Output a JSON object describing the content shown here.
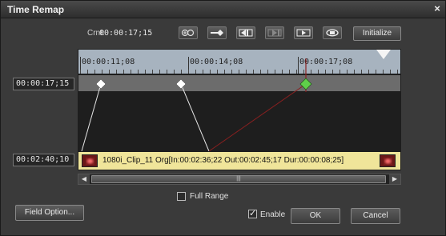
{
  "window": {
    "title": "Time Remap",
    "close_glyph": "×"
  },
  "toolbar": {
    "current_label": "Crnt:",
    "current_timecode": "00:00:17;15",
    "icons": [
      "add-key-icon",
      "prev-key-icon",
      "step-back-icon",
      "step-forward-icon",
      "play-icon",
      "loop-icon"
    ],
    "initialize_label": "Initialize"
  },
  "ruler": {
    "ticks": [
      "00:00:11;08",
      "00:00:14;08",
      "00:00:17;08"
    ]
  },
  "timecodes": {
    "playhead": "00:00:17;15",
    "source": "00:02:40;10"
  },
  "clip": {
    "label": "1080i_Clip_11  Org[In:00:02:36;22 Out:00:02:45;17 Dur:00:00:08;25]"
  },
  "options": {
    "full_range_label": "Full Range",
    "full_range_checked": false,
    "enable_label": "Enable",
    "enable_checked": true
  },
  "buttons": {
    "field_option": "Field Option...",
    "ok": "OK",
    "cancel": "Cancel"
  },
  "colors": {
    "clip_bar": "#f0e59a",
    "keyframe_selected": "#5fcf4a",
    "keyframe": "#ffffff",
    "playhead_line": "#8a2020",
    "ruler_bg": "#a7b3bf"
  }
}
